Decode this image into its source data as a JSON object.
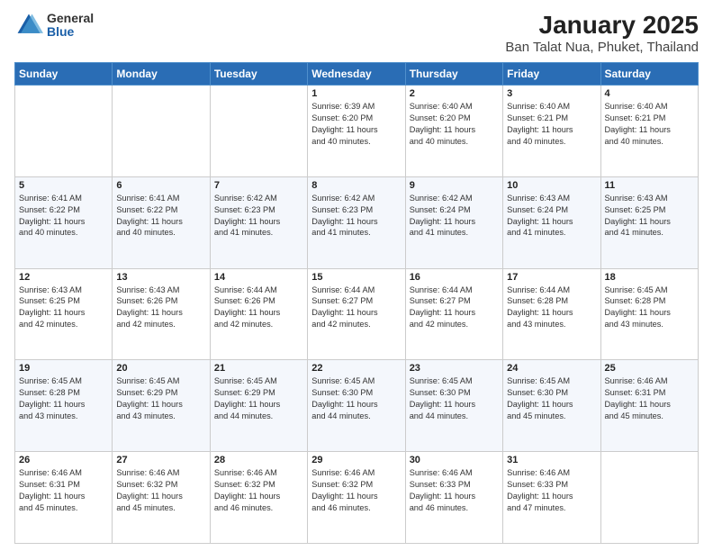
{
  "header": {
    "logo_general": "General",
    "logo_blue": "Blue",
    "main_title": "January 2025",
    "sub_title": "Ban Talat Nua, Phuket, Thailand"
  },
  "days_of_week": [
    "Sunday",
    "Monday",
    "Tuesday",
    "Wednesday",
    "Thursday",
    "Friday",
    "Saturday"
  ],
  "weeks": [
    [
      {
        "day": "",
        "info": ""
      },
      {
        "day": "",
        "info": ""
      },
      {
        "day": "",
        "info": ""
      },
      {
        "day": "1",
        "info": "Sunrise: 6:39 AM\nSunset: 6:20 PM\nDaylight: 11 hours\nand 40 minutes."
      },
      {
        "day": "2",
        "info": "Sunrise: 6:40 AM\nSunset: 6:20 PM\nDaylight: 11 hours\nand 40 minutes."
      },
      {
        "day": "3",
        "info": "Sunrise: 6:40 AM\nSunset: 6:21 PM\nDaylight: 11 hours\nand 40 minutes."
      },
      {
        "day": "4",
        "info": "Sunrise: 6:40 AM\nSunset: 6:21 PM\nDaylight: 11 hours\nand 40 minutes."
      }
    ],
    [
      {
        "day": "5",
        "info": "Sunrise: 6:41 AM\nSunset: 6:22 PM\nDaylight: 11 hours\nand 40 minutes."
      },
      {
        "day": "6",
        "info": "Sunrise: 6:41 AM\nSunset: 6:22 PM\nDaylight: 11 hours\nand 40 minutes."
      },
      {
        "day": "7",
        "info": "Sunrise: 6:42 AM\nSunset: 6:23 PM\nDaylight: 11 hours\nand 41 minutes."
      },
      {
        "day": "8",
        "info": "Sunrise: 6:42 AM\nSunset: 6:23 PM\nDaylight: 11 hours\nand 41 minutes."
      },
      {
        "day": "9",
        "info": "Sunrise: 6:42 AM\nSunset: 6:24 PM\nDaylight: 11 hours\nand 41 minutes."
      },
      {
        "day": "10",
        "info": "Sunrise: 6:43 AM\nSunset: 6:24 PM\nDaylight: 11 hours\nand 41 minutes."
      },
      {
        "day": "11",
        "info": "Sunrise: 6:43 AM\nSunset: 6:25 PM\nDaylight: 11 hours\nand 41 minutes."
      }
    ],
    [
      {
        "day": "12",
        "info": "Sunrise: 6:43 AM\nSunset: 6:25 PM\nDaylight: 11 hours\nand 42 minutes."
      },
      {
        "day": "13",
        "info": "Sunrise: 6:43 AM\nSunset: 6:26 PM\nDaylight: 11 hours\nand 42 minutes."
      },
      {
        "day": "14",
        "info": "Sunrise: 6:44 AM\nSunset: 6:26 PM\nDaylight: 11 hours\nand 42 minutes."
      },
      {
        "day": "15",
        "info": "Sunrise: 6:44 AM\nSunset: 6:27 PM\nDaylight: 11 hours\nand 42 minutes."
      },
      {
        "day": "16",
        "info": "Sunrise: 6:44 AM\nSunset: 6:27 PM\nDaylight: 11 hours\nand 42 minutes."
      },
      {
        "day": "17",
        "info": "Sunrise: 6:44 AM\nSunset: 6:28 PM\nDaylight: 11 hours\nand 43 minutes."
      },
      {
        "day": "18",
        "info": "Sunrise: 6:45 AM\nSunset: 6:28 PM\nDaylight: 11 hours\nand 43 minutes."
      }
    ],
    [
      {
        "day": "19",
        "info": "Sunrise: 6:45 AM\nSunset: 6:28 PM\nDaylight: 11 hours\nand 43 minutes."
      },
      {
        "day": "20",
        "info": "Sunrise: 6:45 AM\nSunset: 6:29 PM\nDaylight: 11 hours\nand 43 minutes."
      },
      {
        "day": "21",
        "info": "Sunrise: 6:45 AM\nSunset: 6:29 PM\nDaylight: 11 hours\nand 44 minutes."
      },
      {
        "day": "22",
        "info": "Sunrise: 6:45 AM\nSunset: 6:30 PM\nDaylight: 11 hours\nand 44 minutes."
      },
      {
        "day": "23",
        "info": "Sunrise: 6:45 AM\nSunset: 6:30 PM\nDaylight: 11 hours\nand 44 minutes."
      },
      {
        "day": "24",
        "info": "Sunrise: 6:45 AM\nSunset: 6:30 PM\nDaylight: 11 hours\nand 45 minutes."
      },
      {
        "day": "25",
        "info": "Sunrise: 6:46 AM\nSunset: 6:31 PM\nDaylight: 11 hours\nand 45 minutes."
      }
    ],
    [
      {
        "day": "26",
        "info": "Sunrise: 6:46 AM\nSunset: 6:31 PM\nDaylight: 11 hours\nand 45 minutes."
      },
      {
        "day": "27",
        "info": "Sunrise: 6:46 AM\nSunset: 6:32 PM\nDaylight: 11 hours\nand 45 minutes."
      },
      {
        "day": "28",
        "info": "Sunrise: 6:46 AM\nSunset: 6:32 PM\nDaylight: 11 hours\nand 46 minutes."
      },
      {
        "day": "29",
        "info": "Sunrise: 6:46 AM\nSunset: 6:32 PM\nDaylight: 11 hours\nand 46 minutes."
      },
      {
        "day": "30",
        "info": "Sunrise: 6:46 AM\nSunset: 6:33 PM\nDaylight: 11 hours\nand 46 minutes."
      },
      {
        "day": "31",
        "info": "Sunrise: 6:46 AM\nSunset: 6:33 PM\nDaylight: 11 hours\nand 47 minutes."
      },
      {
        "day": "",
        "info": ""
      }
    ]
  ]
}
